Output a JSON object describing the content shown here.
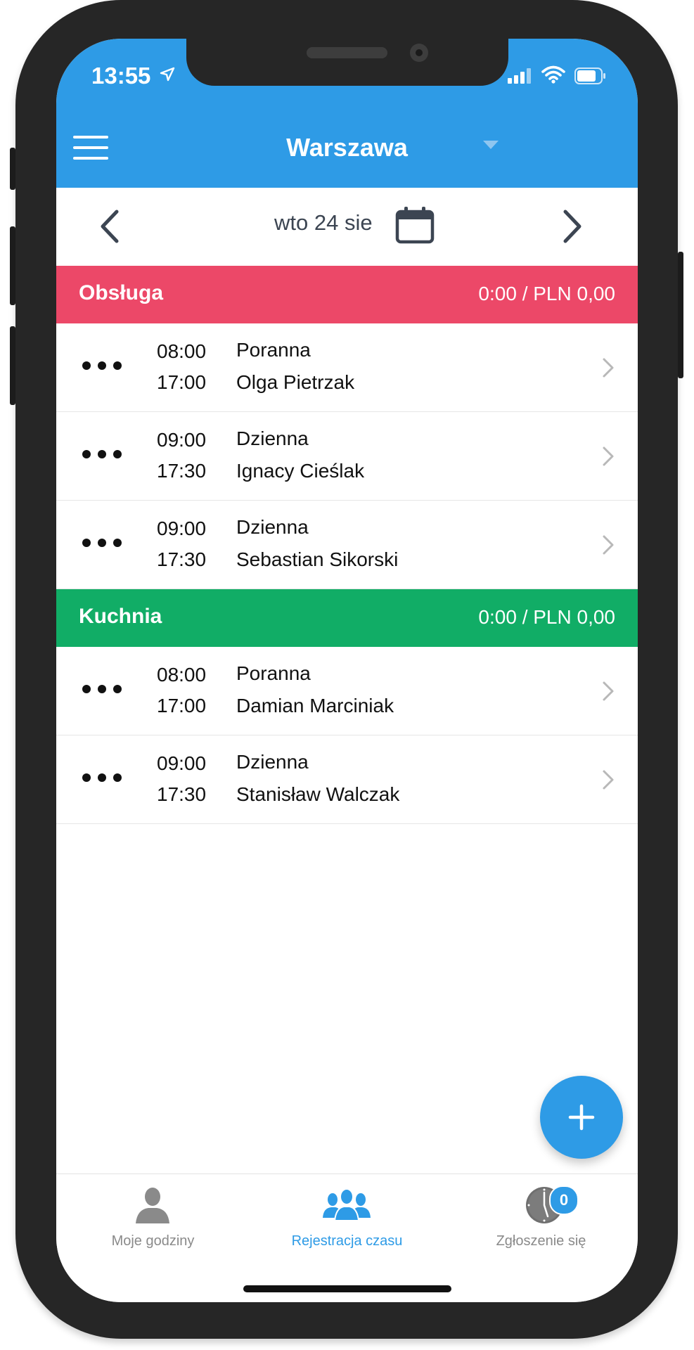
{
  "status_bar": {
    "time": "13:55"
  },
  "header": {
    "location": "Warszawa"
  },
  "date_nav": {
    "date_label": "wto 24 sie"
  },
  "colors": {
    "primary": "#2e9be6",
    "obsluga": "#ec4868",
    "kuchnia": "#11ad66"
  },
  "sections": [
    {
      "name": "Obsługa",
      "total": "0:00 / PLN 0,00",
      "rows": [
        {
          "start": "08:00",
          "end": "17:00",
          "shift": "Poranna",
          "person": "Olga Pietrzak"
        },
        {
          "start": "09:00",
          "end": "17:30",
          "shift": "Dzienna",
          "person": "Ignacy Cieślak"
        },
        {
          "start": "09:00",
          "end": "17:30",
          "shift": "Dzienna",
          "person": "Sebastian Sikorski"
        }
      ]
    },
    {
      "name": "Kuchnia",
      "total": "0:00 / PLN 0,00",
      "rows": [
        {
          "start": "08:00",
          "end": "17:00",
          "shift": "Poranna",
          "person": "Damian Marciniak"
        },
        {
          "start": "09:00",
          "end": "17:30",
          "shift": "Dzienna",
          "person": "Stanisław Walczak"
        }
      ]
    }
  ],
  "tabs": {
    "my_hours": "Moje godziny",
    "time_registration": "Rejestracja czasu",
    "check_in": "Zgłoszenie się",
    "check_in_badge": "0"
  },
  "icons": {
    "menu": "hamburger-icon",
    "prev": "chevron-left-icon",
    "next": "chevron-right-icon",
    "calendar": "calendar-icon",
    "more": "more-dots-icon",
    "row_chevron": "chevron-right-icon",
    "add": "plus-icon",
    "my_hours": "person-icon",
    "registration": "group-icon",
    "check_in": "clock-icon"
  }
}
